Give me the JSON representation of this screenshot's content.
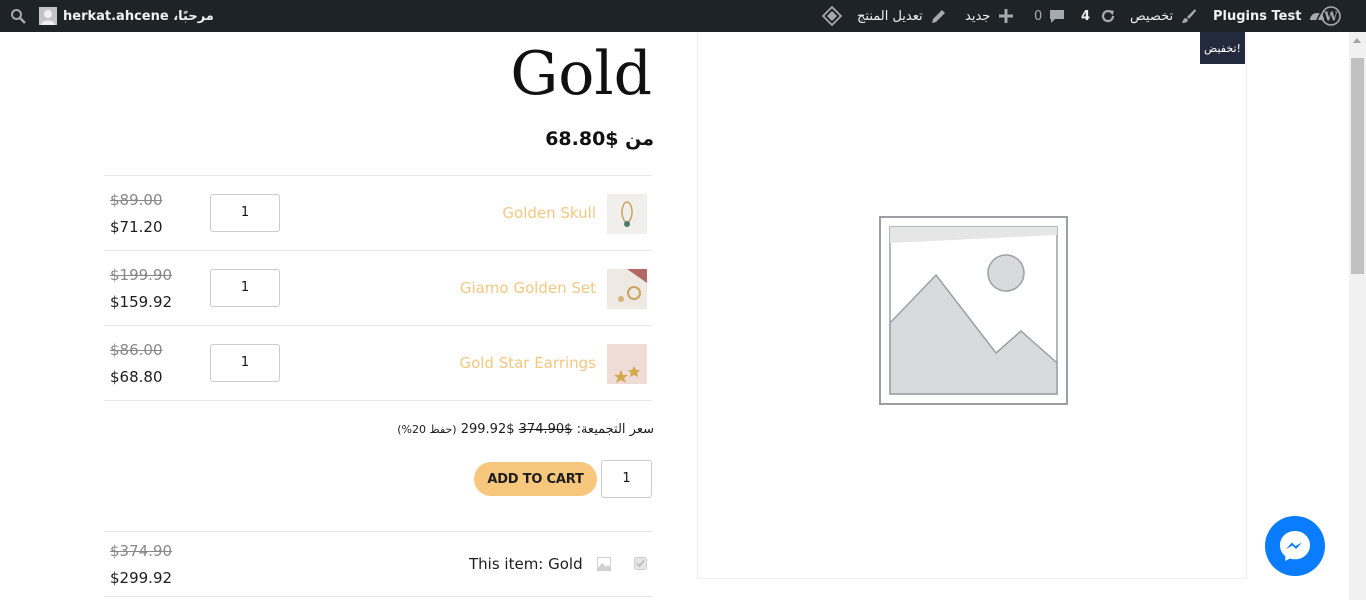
{
  "admin_bar": {
    "site_name": "Plugins Test",
    "customize_label": "تخصيص",
    "updates_count": "4",
    "comments_count": "0",
    "new_label": "جديد",
    "edit_product_label": "تعديل المنتج",
    "greeting": "مرحبًا، herkat.ahcene"
  },
  "product": {
    "title": "Gold",
    "price_from": "من $68.80",
    "sale_badge": "تخفيض!"
  },
  "bundle": {
    "items": [
      {
        "name": "Golden Skull",
        "qty": "1",
        "old_price": "$89.00",
        "new_price": "$71.20"
      },
      {
        "name": "Giamo Golden Set",
        "qty": "1",
        "old_price": "$199.90",
        "new_price": "$159.92"
      },
      {
        "name": "Gold Star Earrings",
        "qty": "1",
        "old_price": "$86.00",
        "new_price": "$68.80"
      }
    ],
    "total_label": "سعر التجميعة:",
    "total_old": "$374.90",
    "total_new": "$299.92",
    "total_save": "(حفظ 20%)",
    "add_to_cart": "ADD TO CART",
    "quantity": "1"
  },
  "this_item": {
    "label": "This item: Gold",
    "old_price": "$374.90",
    "new_price": "$299.92"
  },
  "colors": {
    "accent": "#f7c77e",
    "product_link": "#f3c780",
    "admin_bar": "#1d2327",
    "messenger": "#0a7cff",
    "sale_badge": "#232a3e"
  }
}
